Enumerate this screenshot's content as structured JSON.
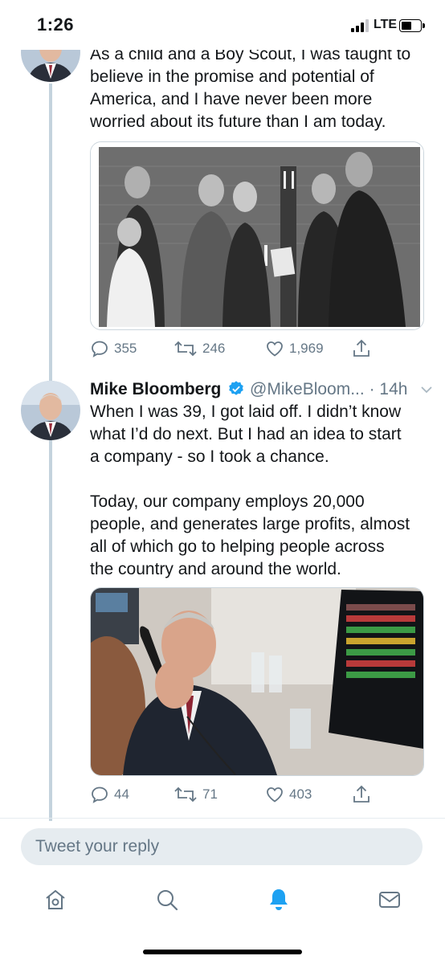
{
  "status_bar": {
    "time": "1:26",
    "network": "LTE"
  },
  "tweet1": {
    "text": "As a child and a Boy Scout, I was taught to\nbelieve in the promise and potential of\nAmerica, and I have never been more\nworried about its future than I am today.",
    "replies": "355",
    "retweets": "246",
    "likes": "1,969"
  },
  "tweet2": {
    "name": "Mike Bloomberg",
    "handle": "@MikeBloom...",
    "time": "· 14h",
    "text": "When I was 39, I got laid off. I didn’t know\nwhat I’d do next. But I had an idea to start\na company - so I took a chance.\n\nToday, our company employs 20,000\npeople, and generates large profits, almost\nall of which go to helping people across\nthe country and around the world.",
    "replies": "44",
    "retweets": "71",
    "likes": "403"
  },
  "reply": {
    "placeholder": "Tweet your reply"
  },
  "colors": {
    "twitter_blue": "#1da1f2",
    "icon_gray": "#657786",
    "thread_line": "#c4d3dd",
    "reply_box_bg": "#e6ecf0"
  },
  "tabbar": {
    "active": "notifications-icon"
  }
}
